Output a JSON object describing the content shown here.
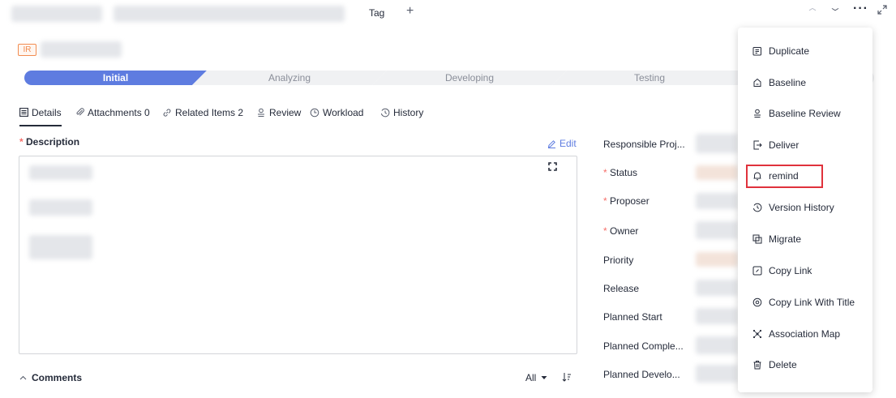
{
  "header": {
    "tag_label": "Tag",
    "add_tag_symbol": "+",
    "more_symbol": "···"
  },
  "item": {
    "type_badge": "IR"
  },
  "workflow": {
    "steps": [
      "Initial",
      "Analyzing",
      "Developing",
      "Testing"
    ],
    "active_index": 0,
    "active_color": "#5e7ce0"
  },
  "tabs": [
    {
      "label": "Details",
      "icon": "details-icon",
      "active": true
    },
    {
      "label": "Attachments 0",
      "icon": "attachment-icon"
    },
    {
      "label": "Related Items 2",
      "icon": "link-icon"
    },
    {
      "label": "Review",
      "icon": "review-icon"
    },
    {
      "label": "Workload",
      "icon": "clock-icon"
    },
    {
      "label": "History",
      "icon": "history-icon"
    }
  ],
  "description": {
    "required_mark": "*",
    "title": "Description",
    "edit_label": "Edit"
  },
  "comments": {
    "title": "Comments",
    "filter_value": "All"
  },
  "fields": [
    {
      "label": "Responsible Proj...",
      "required": false
    },
    {
      "label": "Status",
      "required": true
    },
    {
      "label": "Proposer",
      "required": true
    },
    {
      "label": "Owner",
      "required": true
    },
    {
      "label": "Priority",
      "required": false
    },
    {
      "label": "Release",
      "required": false
    },
    {
      "label": "Planned Start",
      "required": false
    },
    {
      "label": "Planned Comple...",
      "required": false
    },
    {
      "label": "Planned Develo...",
      "required": false
    }
  ],
  "menu": {
    "items": [
      {
        "label": "Duplicate",
        "icon": "duplicate-icon"
      },
      {
        "label": "Baseline",
        "icon": "baseline-icon"
      },
      {
        "label": "Baseline Review",
        "icon": "baseline-review-icon"
      },
      {
        "label": "Deliver",
        "icon": "deliver-icon"
      },
      {
        "label": "remind",
        "icon": "bell-icon"
      },
      {
        "label": "Version History",
        "icon": "version-history-icon"
      },
      {
        "label": "Migrate",
        "icon": "migrate-icon"
      },
      {
        "label": "Copy Link",
        "icon": "copy-link-icon"
      },
      {
        "label": "Copy Link With Title",
        "icon": "copy-link-title-icon"
      },
      {
        "label": "Association Map",
        "icon": "association-map-icon"
      },
      {
        "label": "Delete",
        "icon": "trash-icon"
      }
    ],
    "highlighted_item": "remind",
    "highlight_color": "#e0323c"
  }
}
